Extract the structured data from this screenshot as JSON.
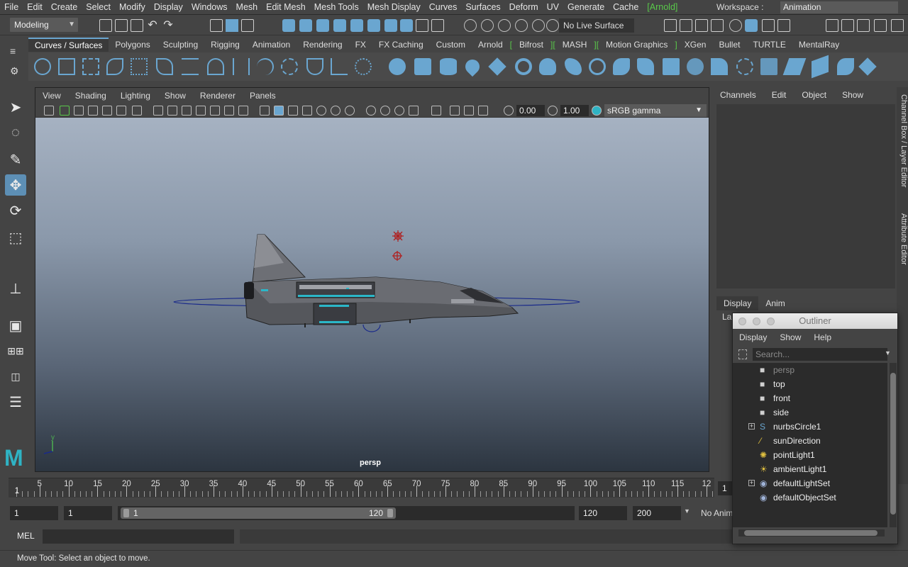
{
  "menubar": {
    "items": [
      "File",
      "Edit",
      "Create",
      "Select",
      "Modify",
      "Display",
      "Windows",
      "Mesh",
      "Edit Mesh",
      "Mesh Tools",
      "Mesh Display",
      "Curves",
      "Surfaces",
      "Deform",
      "UV",
      "Generate",
      "Cache"
    ],
    "arnold": "[Arnold]",
    "workspace_label": "Workspace :",
    "workspace_value": "Animation"
  },
  "statusline": {
    "mode": "Modeling",
    "live_surface": "No Live Surface"
  },
  "shelf": {
    "tabs": [
      "Curves / Surfaces",
      "Polygons",
      "Sculpting",
      "Rigging",
      "Animation",
      "Rendering",
      "FX",
      "FX Caching",
      "Custom",
      "Arnold",
      "Bifrost",
      "MASH",
      "Motion Graphics",
      "XGen",
      "Bullet",
      "TURTLE",
      "MentalRay"
    ],
    "brackets": [
      "[",
      "][",
      "][",
      "]"
    ]
  },
  "viewport": {
    "menu": [
      "View",
      "Shading",
      "Lighting",
      "Show",
      "Renderer",
      "Panels"
    ],
    "exposure": "0.00",
    "gamma": "1.00",
    "color_space": "sRGB gamma",
    "camera": "persp",
    "axis_y": "y"
  },
  "timeline": {
    "ticks": [
      "5",
      "10",
      "15",
      "20",
      "25",
      "30",
      "35",
      "40",
      "45",
      "50",
      "55",
      "60",
      "65",
      "70",
      "75",
      "80",
      "85",
      "90",
      "95",
      "100",
      "105",
      "110",
      "115",
      "12"
    ],
    "current_frame": "1",
    "current_frame_field": "1"
  },
  "range": {
    "start": "1",
    "playback_start": "1",
    "slider_start": "1",
    "slider_end": "120",
    "playback_end": "120",
    "end": "200",
    "anim_layer": "No Anim Layer"
  },
  "cmdline": {
    "mel": "MEL"
  },
  "helpline": {
    "text": "Move Tool: Select an object to move."
  },
  "channelbox": {
    "menu": [
      "Channels",
      "Edit",
      "Object",
      "Show"
    ]
  },
  "sidetabs": {
    "channel": "Channel Box / Layer Editor",
    "attribute": "Attribute Editor"
  },
  "layereditor": {
    "tabs": [
      "Display",
      "Anim"
    ],
    "label": "La"
  },
  "outliner": {
    "title": "Outliner",
    "menu": [
      "Display",
      "Show",
      "Help"
    ],
    "search_placeholder": "Search...",
    "items": [
      {
        "label": "persp",
        "icon": "camera-icon",
        "dim": true,
        "expand": false
      },
      {
        "label": "top",
        "icon": "camera-icon",
        "dim": false,
        "expand": false
      },
      {
        "label": "front",
        "icon": "camera-icon",
        "dim": false,
        "expand": false
      },
      {
        "label": "side",
        "icon": "camera-icon",
        "dim": false,
        "expand": false
      },
      {
        "label": "nurbsCircle1",
        "icon": "curve-icon",
        "dim": false,
        "expand": true
      },
      {
        "label": "sunDirection",
        "icon": "directional-light-icon",
        "dim": false,
        "expand": false
      },
      {
        "label": "pointLight1",
        "icon": "point-light-icon",
        "dim": false,
        "expand": false
      },
      {
        "label": "ambientLight1",
        "icon": "ambient-light-icon",
        "dim": false,
        "expand": false
      },
      {
        "label": "defaultLightSet",
        "icon": "set-icon",
        "dim": false,
        "expand": true
      },
      {
        "label": "defaultObjectSet",
        "icon": "set-icon",
        "dim": false,
        "expand": false
      }
    ]
  },
  "colors": {
    "accent": "#6aa6d0",
    "arnold_green": "#59c84a",
    "panel": "#444444"
  }
}
